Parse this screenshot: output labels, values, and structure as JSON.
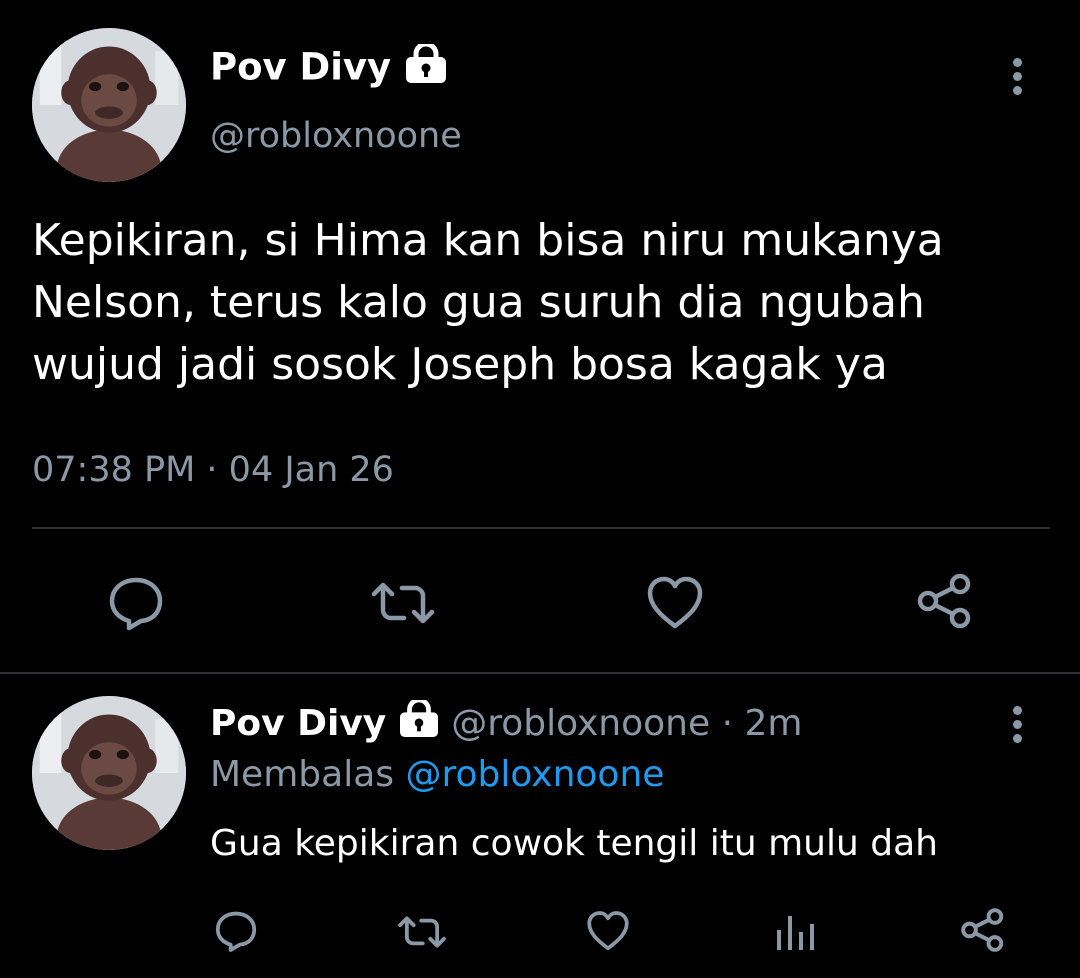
{
  "main_tweet": {
    "display_name": "Pov Divy",
    "handle": "@robloxnoone",
    "text_lines": [
      "Kepikiran, si Hima kan bisa niru mukanya",
      "Nelson, terus kalo gua suruh dia ngubah",
      "wujud jadi sosok Joseph bosa kagak ya"
    ],
    "timestamp": "07:38 PM · 04 Jan 26",
    "actions": [
      "reply-icon",
      "retweet-icon",
      "like-icon",
      "share-icon"
    ]
  },
  "reply_tweet": {
    "display_name": "Pov Divy",
    "handle": "@robloxnoone",
    "time_sep": "·",
    "time": "2m",
    "replying_prefix": "Membalas",
    "replying_to": "@robloxnoone",
    "text": "Gua kepikiran cowok tengil itu mulu dah",
    "actions": [
      "reply-icon",
      "retweet-icon",
      "like-icon",
      "analytics-icon",
      "share-icon"
    ]
  },
  "colors": {
    "background": "#000000",
    "text": "#e7e9ea",
    "muted": "#8b98a5",
    "link": "#1d9bf0",
    "divider": "#2f3336"
  }
}
